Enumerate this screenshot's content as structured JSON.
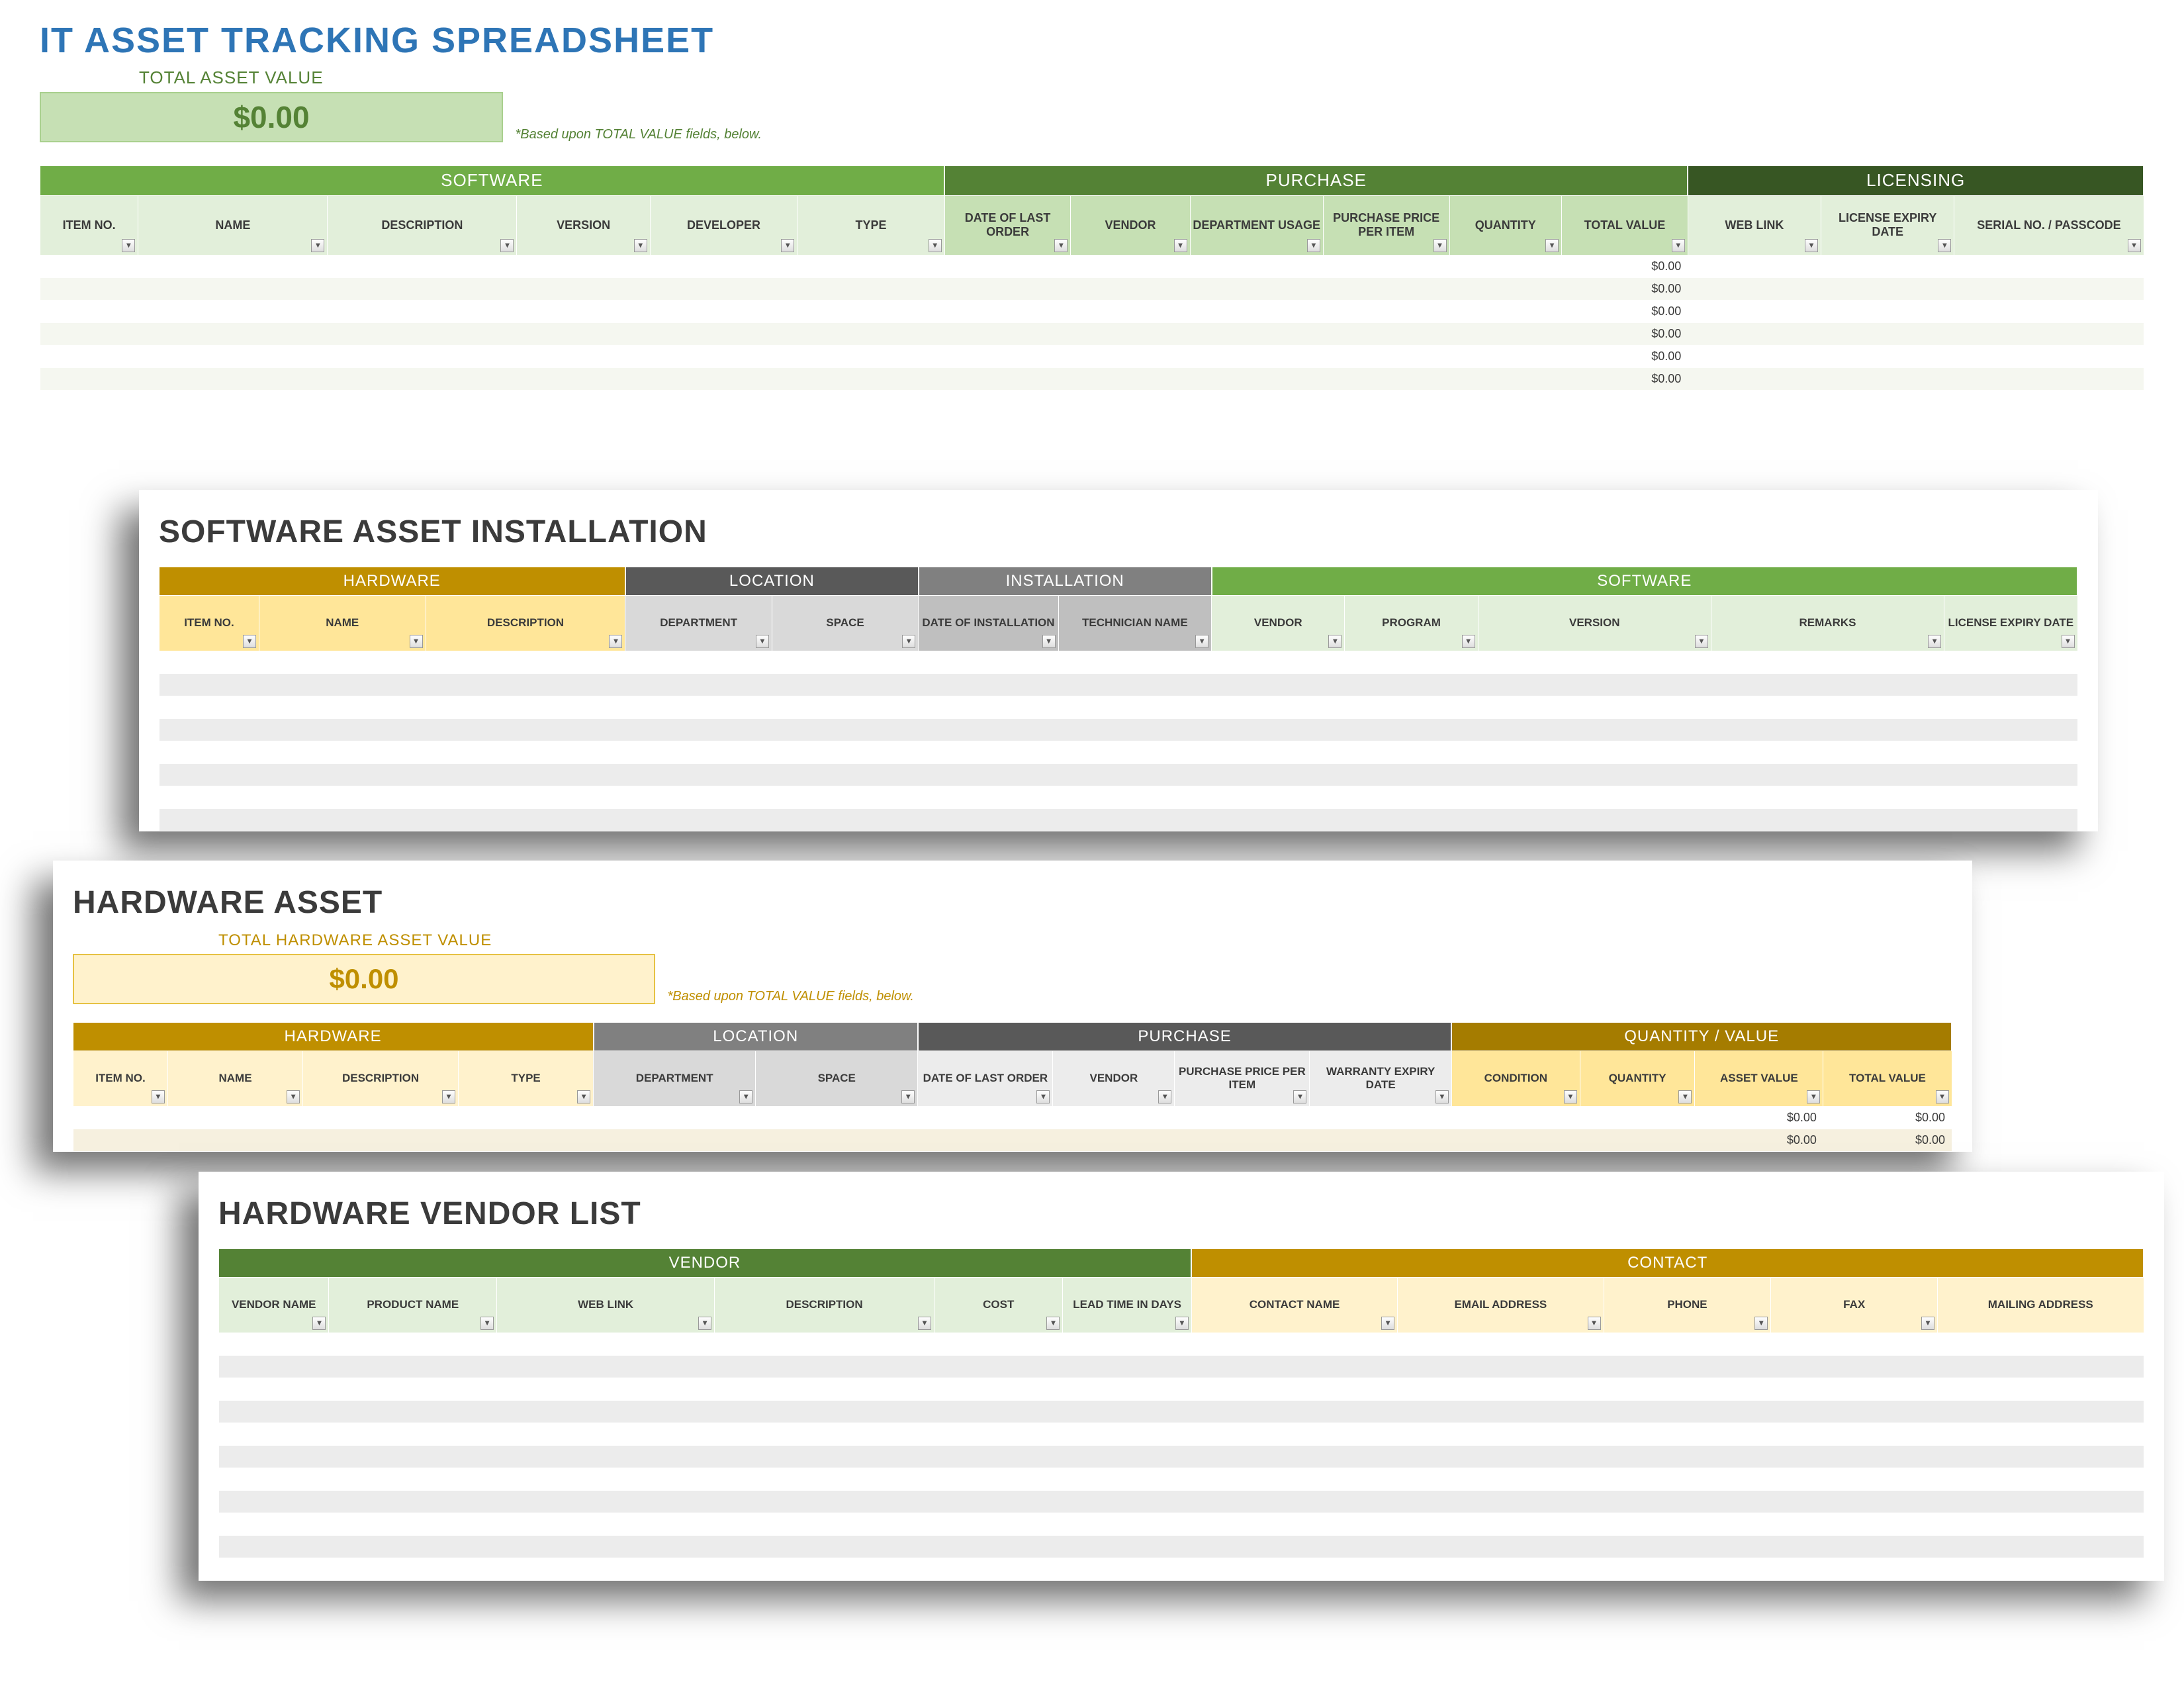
{
  "sheet1": {
    "title": "IT ASSET TRACKING SPREADSHEET",
    "totalLabel": "TOTAL ASSET VALUE",
    "totalValue": "$0.00",
    "note": "*Based upon TOTAL VALUE fields, below.",
    "groups": {
      "software": "SOFTWARE",
      "purchase": "PURCHASE",
      "licensing": "LICENSING"
    },
    "cols": {
      "itemNo": "ITEM NO.",
      "name": "NAME",
      "description": "DESCRIPTION",
      "version": "VERSION",
      "developer": "DEVELOPER",
      "type": "TYPE",
      "dateLastOrder": "DATE OF LAST ORDER",
      "vendor": "VENDOR",
      "deptUsage": "DEPARTMENT USAGE",
      "pricePerItem": "PURCHASE PRICE PER ITEM",
      "quantity": "QUANTITY",
      "totalValue": "TOTAL VALUE",
      "webLink": "WEB LINK",
      "licenseExpiry": "LICENSE EXPIRY DATE",
      "serialPasscode": "SERIAL NO. / PASSCODE"
    },
    "rows": [
      {
        "totalValue": "$0.00"
      },
      {
        "totalValue": "$0.00"
      },
      {
        "totalValue": "$0.00"
      },
      {
        "totalValue": "$0.00"
      },
      {
        "totalValue": "$0.00"
      },
      {
        "totalValue": "$0.00"
      }
    ]
  },
  "sheet2": {
    "title": "SOFTWARE ASSET INSTALLATION",
    "groups": {
      "hardware": "HARDWARE",
      "location": "LOCATION",
      "installation": "INSTALLATION",
      "software": "SOFTWARE"
    },
    "cols": {
      "itemNo": "ITEM NO.",
      "name": "NAME",
      "description": "DESCRIPTION",
      "department": "DEPARTMENT",
      "space": "SPACE",
      "dateInstall": "DATE OF INSTALLATION",
      "tech": "TECHNICIAN NAME",
      "vendor": "VENDOR",
      "program": "PROGRAM",
      "version": "VERSION",
      "remarks": "REMARKS",
      "licenseExpiry": "LICENSE EXPIRY DATE"
    },
    "rowCount": 8
  },
  "sheet3": {
    "title": "HARDWARE ASSET",
    "totalLabel": "TOTAL HARDWARE ASSET VALUE",
    "totalValue": "$0.00",
    "note": "*Based upon TOTAL VALUE fields, below.",
    "groups": {
      "hardware": "HARDWARE",
      "location": "LOCATION",
      "purchase": "PURCHASE",
      "qtyVal": "QUANTITY / VALUE"
    },
    "cols": {
      "itemNo": "ITEM NO.",
      "name": "NAME",
      "description": "DESCRIPTION",
      "type": "TYPE",
      "department": "DEPARTMENT",
      "space": "SPACE",
      "dateLastOrder": "DATE OF LAST ORDER",
      "vendor": "VENDOR",
      "pricePerItem": "PURCHASE PRICE PER ITEM",
      "warrantyExpiry": "WARRANTY EXPIRY DATE",
      "condition": "CONDITION",
      "quantity": "QUANTITY",
      "assetValue": "ASSET VALUE",
      "totalValue": "TOTAL VALUE"
    },
    "rows": [
      {
        "assetValue": "$0.00",
        "totalValue": "$0.00"
      },
      {
        "assetValue": "$0.00",
        "totalValue": "$0.00"
      }
    ]
  },
  "sheet4": {
    "title": "HARDWARE VENDOR LIST",
    "groups": {
      "vendor": "VENDOR",
      "contact": "CONTACT"
    },
    "cols": {
      "vendorName": "VENDOR NAME",
      "productName": "PRODUCT NAME",
      "webLink": "WEB LINK",
      "description": "DESCRIPTION",
      "cost": "COST",
      "leadTime": "LEAD TIME IN DAYS",
      "contactName": "CONTACT NAME",
      "email": "EMAIL ADDRESS",
      "phone": "PHONE",
      "fax": "FAX",
      "mailing": "MAILING ADDRESS"
    },
    "rowCount": 11
  }
}
